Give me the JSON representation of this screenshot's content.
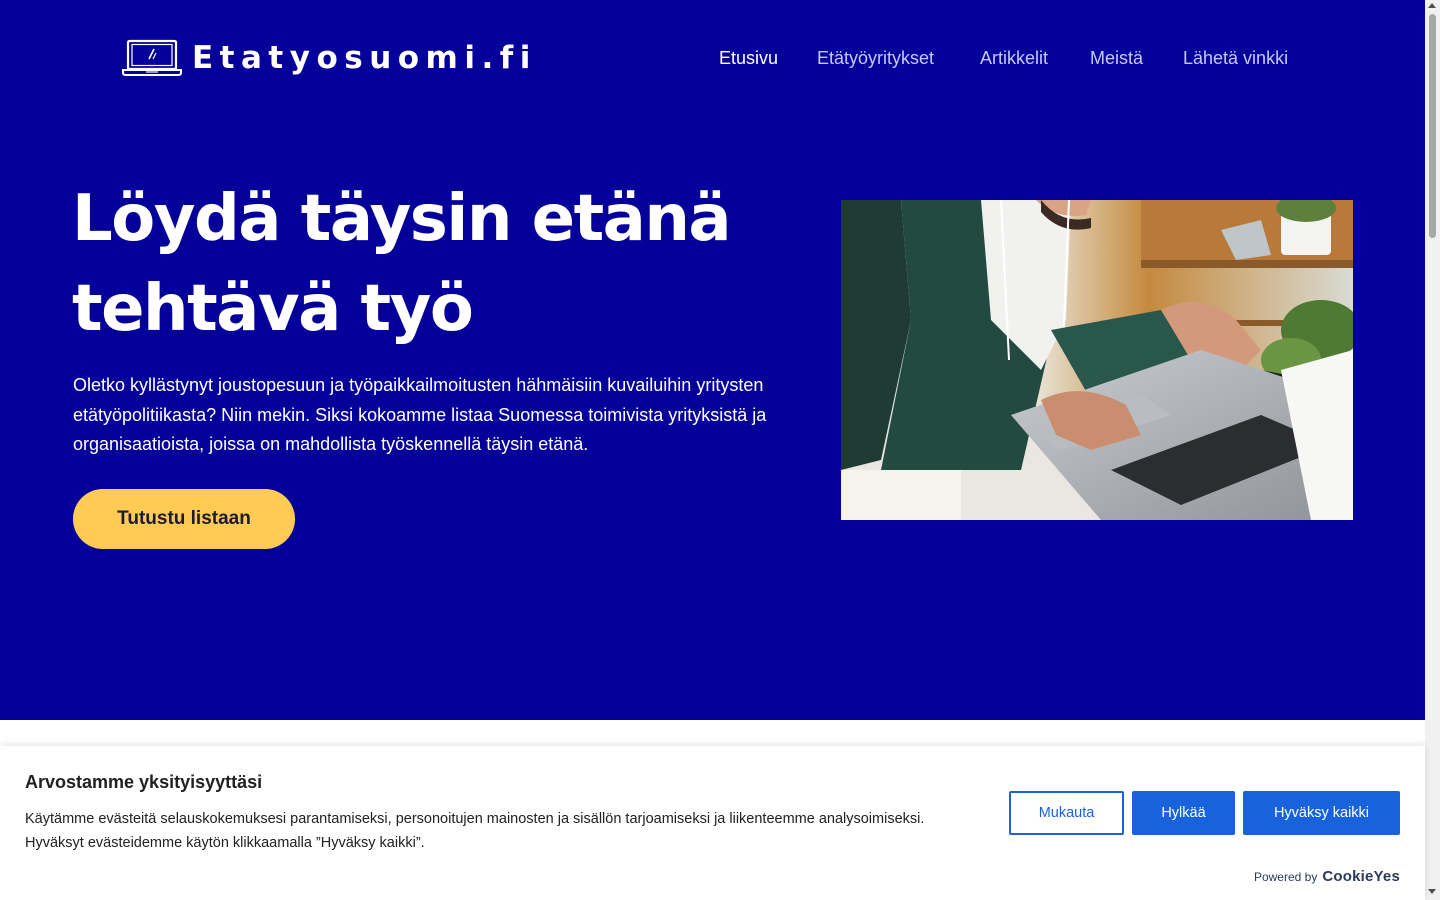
{
  "site": {
    "logo_text": "Etatyosuomi.fi",
    "logo_icon": "laptop-icon"
  },
  "nav": {
    "items": [
      {
        "label": "Etusivu",
        "active": true
      },
      {
        "label": "Etätyöyritykset",
        "active": false
      },
      {
        "label": "Artikkelit",
        "active": false
      },
      {
        "label": "Meistä",
        "active": false
      },
      {
        "label": "Lähetä vinkki",
        "active": false
      }
    ]
  },
  "hero": {
    "title_line1": "Löydä täysin etänä",
    "title_line2": "tehtävä työ",
    "description": "Oletko kyllästynyt joustopesuun ja työpaikkailmoitusten hähmäisiin kuvailuihin yritysten etätyöpolitiikasta? Niin mekin. Siksi kokoamme listaa Suomessa toimivista yrityksistä ja organisaatioista, joissa on mahdollista työskennellä täysin etänä.",
    "cta_label": "Tutustu listaan"
  },
  "cookie_banner": {
    "title": "Arvostamme yksityisyyttäsi",
    "text": "Käytämme evästeitä selauskokemuksesi parantamiseksi, personoitujen mainosten ja sisällön tarjoamiseksi ja liikenteemme analysoimiseksi. Hyväksyt evästeidemme käytön klikkaamalla ”Hyväksy kaikki”.",
    "customize_label": "Mukauta",
    "reject_label": "Hylkää",
    "accept_label": "Hyväksy kaikki",
    "powered_by_label": "Powered by",
    "powered_by_brand": "CookieYes"
  },
  "colors": {
    "hero_background": "#06009a",
    "cta_background": "#ffcb52",
    "nav_active": "#ffffff",
    "nav_inactive": "#c6c9ff",
    "cookie_accent": "#1863dc"
  }
}
